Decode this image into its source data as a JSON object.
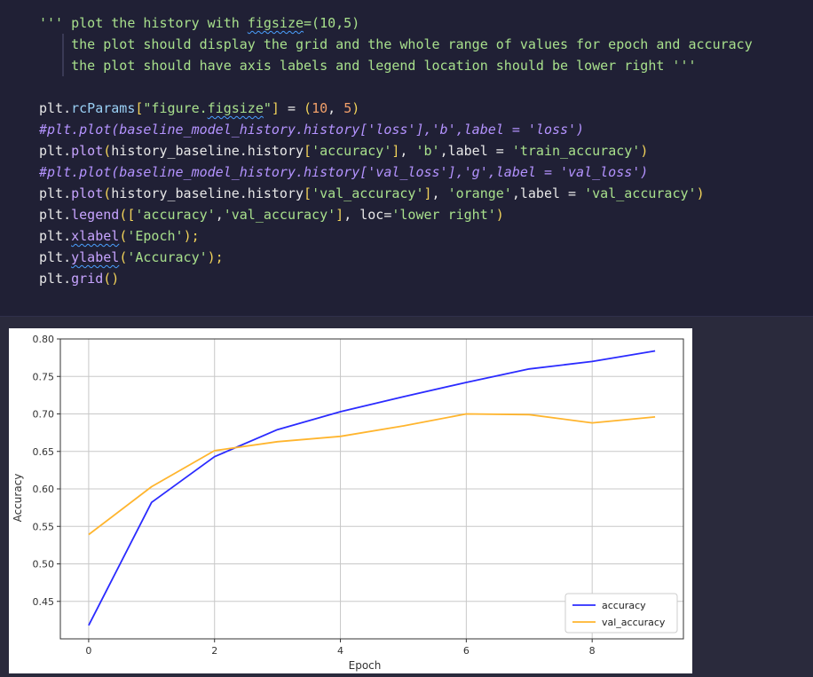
{
  "code_cell": {
    "lines": [
      [
        {
          "t": "''' plot the history with ",
          "c": "str"
        },
        {
          "t": "figsize",
          "c": "str",
          "sq": true
        },
        {
          "t": "=(10,5)",
          "c": "str"
        }
      ],
      [
        {
          "t": "    the plot should display the grid and the whole range of values for epoch and accuracy",
          "c": "str"
        }
      ],
      [
        {
          "t": "    the plot should have axis labels and legend location should be lower right '''",
          "c": "str"
        }
      ],
      [
        {
          "t": " ",
          "c": "txt"
        }
      ],
      [
        {
          "t": "plt.",
          "c": "txt"
        },
        {
          "t": "rcParams",
          "c": "kw"
        },
        {
          "t": "[",
          "c": "punc"
        },
        {
          "t": "\"figure.",
          "c": "str"
        },
        {
          "t": "figsize",
          "c": "str",
          "sq": true
        },
        {
          "t": "\"",
          "c": "str"
        },
        {
          "t": "]",
          "c": "punc"
        },
        {
          "t": " = ",
          "c": "op"
        },
        {
          "t": "(",
          "c": "punc"
        },
        {
          "t": "10",
          "c": "num"
        },
        {
          "t": ", ",
          "c": "txt"
        },
        {
          "t": "5",
          "c": "num"
        },
        {
          "t": ")",
          "c": "punc"
        }
      ],
      [
        {
          "t": "#plt.plot(baseline_model_history.history['loss'],'b',label = 'loss')",
          "c": "cmt"
        }
      ],
      [
        {
          "t": "plt.",
          "c": "txt"
        },
        {
          "t": "plot",
          "c": "fn"
        },
        {
          "t": "(",
          "c": "punc"
        },
        {
          "t": "history_baseline.history",
          "c": "txt"
        },
        {
          "t": "[",
          "c": "punc"
        },
        {
          "t": "'accuracy'",
          "c": "str"
        },
        {
          "t": "]",
          "c": "punc"
        },
        {
          "t": ", ",
          "c": "txt"
        },
        {
          "t": "'b'",
          "c": "str"
        },
        {
          "t": ",label = ",
          "c": "txt"
        },
        {
          "t": "'train_accuracy'",
          "c": "str"
        },
        {
          "t": ")",
          "c": "punc"
        }
      ],
      [
        {
          "t": "#plt.plot(baseline_model_history.history['val_loss'],'g',label = 'val_loss')",
          "c": "cmt"
        }
      ],
      [
        {
          "t": "plt.",
          "c": "txt"
        },
        {
          "t": "plot",
          "c": "fn"
        },
        {
          "t": "(",
          "c": "punc"
        },
        {
          "t": "history_baseline.history",
          "c": "txt"
        },
        {
          "t": "[",
          "c": "punc"
        },
        {
          "t": "'val_accuracy'",
          "c": "str"
        },
        {
          "t": "]",
          "c": "punc"
        },
        {
          "t": ", ",
          "c": "txt"
        },
        {
          "t": "'orange'",
          "c": "str"
        },
        {
          "t": ",label = ",
          "c": "txt"
        },
        {
          "t": "'val_accuracy'",
          "c": "str"
        },
        {
          "t": ")",
          "c": "punc"
        }
      ],
      [
        {
          "t": "plt.",
          "c": "txt"
        },
        {
          "t": "legend",
          "c": "fn"
        },
        {
          "t": "([",
          "c": "punc"
        },
        {
          "t": "'accuracy'",
          "c": "str"
        },
        {
          "t": ",",
          "c": "txt"
        },
        {
          "t": "'val_accuracy'",
          "c": "str"
        },
        {
          "t": "]",
          "c": "punc"
        },
        {
          "t": ", loc=",
          "c": "txt"
        },
        {
          "t": "'lower right'",
          "c": "str"
        },
        {
          "t": ")",
          "c": "punc"
        }
      ],
      [
        {
          "t": "plt.",
          "c": "txt"
        },
        {
          "t": "xlabel",
          "c": "fn",
          "sq": true
        },
        {
          "t": "(",
          "c": "punc"
        },
        {
          "t": "'Epoch'",
          "c": "str"
        },
        {
          "t": ");",
          "c": "punc"
        }
      ],
      [
        {
          "t": "plt.",
          "c": "txt"
        },
        {
          "t": "ylabel",
          "c": "fn",
          "sq": true
        },
        {
          "t": "(",
          "c": "punc"
        },
        {
          "t": "'Accuracy'",
          "c": "str"
        },
        {
          "t": ");",
          "c": "punc"
        }
      ],
      [
        {
          "t": "plt.",
          "c": "txt"
        },
        {
          "t": "grid",
          "c": "fn"
        },
        {
          "t": "()",
          "c": "punc"
        }
      ]
    ]
  },
  "colors": {
    "str": "#a8e08c",
    "fn": "#c7a4ff",
    "punc": "#f2d35a",
    "num": "#f2a06a",
    "cmt": "#b493ff",
    "txt": "#e8e8e8",
    "op": "#e8e8e8",
    "kw": "#9ad0f5",
    "accuracy_line": "#2b2bff",
    "val_accuracy_line": "#ffb52e"
  },
  "chart_data": {
    "type": "line",
    "xlabel": "Epoch",
    "ylabel": "Accuracy",
    "x": [
      0,
      1,
      2,
      3,
      4,
      5,
      6,
      7,
      8,
      9
    ],
    "xlim": [
      -0.45,
      9.45
    ],
    "ylim": [
      0.4,
      0.8
    ],
    "xticks": [
      "0",
      "2",
      "4",
      "6",
      "8"
    ],
    "yticks": [
      "0.45",
      "0.50",
      "0.55",
      "0.60",
      "0.65",
      "0.70",
      "0.75",
      "0.80"
    ],
    "grid": true,
    "legend_loc": "lower right",
    "series": [
      {
        "name": "accuracy",
        "color": "#2b2bff",
        "values": [
          0.418,
          0.582,
          0.643,
          0.679,
          0.703,
          0.723,
          0.742,
          0.76,
          0.77,
          0.784
        ]
      },
      {
        "name": "val_accuracy",
        "color": "#ffb52e",
        "values": [
          0.539,
          0.603,
          0.651,
          0.663,
          0.67,
          0.684,
          0.7,
          0.699,
          0.688,
          0.696
        ]
      }
    ]
  }
}
